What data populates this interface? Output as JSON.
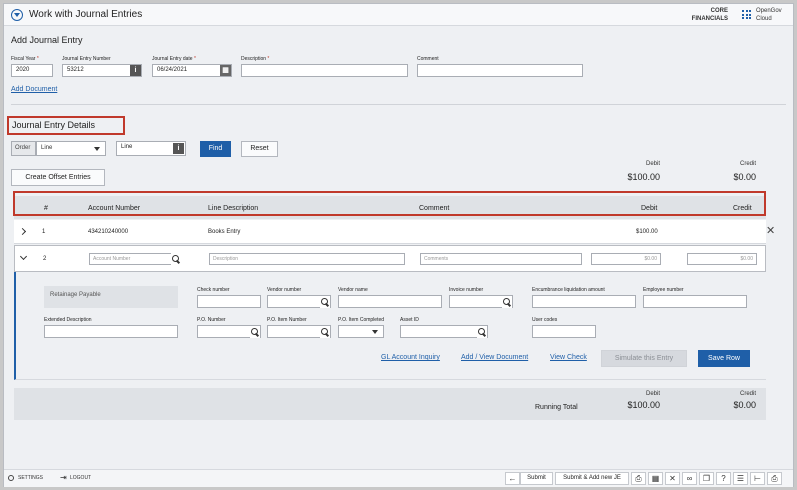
{
  "header": {
    "title": "Work with Journal Entries",
    "product_line1": "CORE",
    "product_line2": "FINANCIALS",
    "brand_line1": "OpenGov",
    "brand_line2": "Cloud"
  },
  "add_entry": {
    "heading": "Add Journal Entry",
    "fiscal_year_label": "Fiscal Year",
    "fiscal_year": "2020",
    "je_number_label": "Journal Entry Number",
    "je_number": "53212",
    "je_date_label": "Journal Entry date",
    "je_date": "06/24/2021",
    "description_label": "Description",
    "description": "",
    "comment_label": "Comment",
    "comment": "",
    "add_document": "Add Document"
  },
  "details": {
    "heading": "Journal Entry Details",
    "order_label": "Order",
    "order_value": "Line",
    "line_value": "Line",
    "find": "Find",
    "reset": "Reset",
    "offset": "Create Offset Entries",
    "debit_label": "Debit",
    "debit_total": "$100.00",
    "credit_label": "Credit",
    "credit_total": "$0.00"
  },
  "table": {
    "headers": {
      "num": "#",
      "account": "Account Number",
      "line_desc": "Line Description",
      "comment": "Comment",
      "debit": "Debit",
      "credit": "Credit"
    },
    "rows": [
      {
        "num": "1",
        "account": "434210240000",
        "line_desc": "Books Entry",
        "comment": "",
        "debit": "$100.00",
        "credit": ""
      }
    ],
    "edit_row": {
      "num": "2",
      "account_ph": "Account Number",
      "desc_ph": "Description",
      "comments_ph": "Comments",
      "debit_ph": "$0.00",
      "credit_ph": "$0.00"
    }
  },
  "row_detail": {
    "retainage": "Retainage Payable",
    "check_number": "Check number",
    "vendor_number": "Vendor number",
    "vendor_name": "Vendor name",
    "invoice_number": "Invoice number",
    "encumbrance": "Encumbrance liquidation amount",
    "employee_number": "Employee number",
    "extended_desc": "Extended Description",
    "po_number": "P.O. Number",
    "po_item_number": "P.O. Item Number",
    "po_item_completed": "P.O. Item Completed",
    "asset_id": "Asset ID",
    "user_codes": "User codes",
    "gl_inquiry": "GL Account Inquiry",
    "add_view_doc": "Add / View Document",
    "view_check": "View Check",
    "simulate": "Simulate this Entry",
    "save_row": "Save Row"
  },
  "running_total": {
    "label": "Running Total",
    "debit_label": "Debit",
    "debit": "$100.00",
    "credit_label": "Credit",
    "credit": "$0.00"
  },
  "footer": {
    "settings": "SETTINGS",
    "logout": "LOGOUT",
    "submit": "Submit",
    "submit_add": "Submit & Add new JE"
  }
}
